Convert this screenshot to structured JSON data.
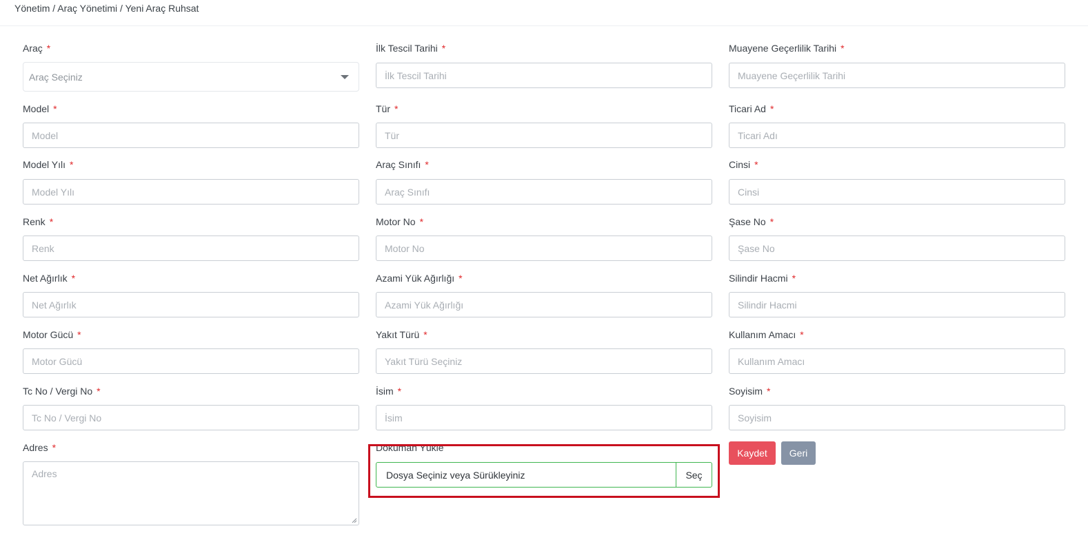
{
  "breadcrumb": {
    "text": "Yönetim / Araç Yönetimi / Yeni Araç Ruhsat"
  },
  "required_mark": "*",
  "fields": {
    "arac": {
      "label": "Araç",
      "placeholder": "Araç Seçiniz"
    },
    "ilk_tescil": {
      "label": "İlk Tescil Tarihi",
      "placeholder": "İlk Tescil Tarihi"
    },
    "muayene": {
      "label": "Muayene Geçerlilik Tarihi",
      "placeholder": "Muayene Geçerlilik Tarihi"
    },
    "model": {
      "label": "Model",
      "placeholder": "Model"
    },
    "tur": {
      "label": "Tür",
      "placeholder": "Tür"
    },
    "ticari_ad": {
      "label": "Ticari Ad",
      "placeholder": "Ticari Adı"
    },
    "model_yili": {
      "label": "Model Yılı",
      "placeholder": "Model Yılı"
    },
    "arac_sinifi": {
      "label": "Araç Sınıfı",
      "placeholder": "Araç Sınıfı"
    },
    "cinsi": {
      "label": "Cinsi",
      "placeholder": "Cinsi"
    },
    "renk": {
      "label": "Renk",
      "placeholder": "Renk"
    },
    "motor_no": {
      "label": "Motor No",
      "placeholder": "Motor No"
    },
    "sase_no": {
      "label": "Şase No",
      "placeholder": "Şase No"
    },
    "net_agirlik": {
      "label": "Net Ağırlık",
      "placeholder": "Net Ağırlık"
    },
    "azami_yuk": {
      "label": "Azami Yük Ağırlığı",
      "placeholder": "Azami Yük Ağırlığı"
    },
    "silindir": {
      "label": "Silindir Hacmi",
      "placeholder": "Silindir Hacmi"
    },
    "motor_gucu": {
      "label": "Motor Gücü",
      "placeholder": "Motor Gücü"
    },
    "yakit": {
      "label": "Yakıt Türü",
      "placeholder": "Yakıt Türü Seçiniz"
    },
    "kullanim": {
      "label": "Kullanım Amacı",
      "placeholder": "Kullanım Amacı"
    },
    "tc_vergi": {
      "label": "Tc No / Vergi No",
      "placeholder": "Tc No / Vergi No"
    },
    "isim": {
      "label": "İsim",
      "placeholder": "İsim"
    },
    "soyisim": {
      "label": "Soyisim",
      "placeholder": "Soyisim"
    },
    "adres": {
      "label": "Adres",
      "placeholder": "Adres"
    }
  },
  "upload": {
    "label": "Doküman Yükle",
    "text": "Dosya Seçiniz veya Sürükleyiniz",
    "button": "Seç"
  },
  "actions": {
    "save": "Kaydet",
    "back": "Geri"
  },
  "colors": {
    "save_button": "#e8505d",
    "back_button": "#8693a6",
    "required": "#e0292b",
    "upload_border": "#3fb64f",
    "highlight": "#c8101e"
  }
}
